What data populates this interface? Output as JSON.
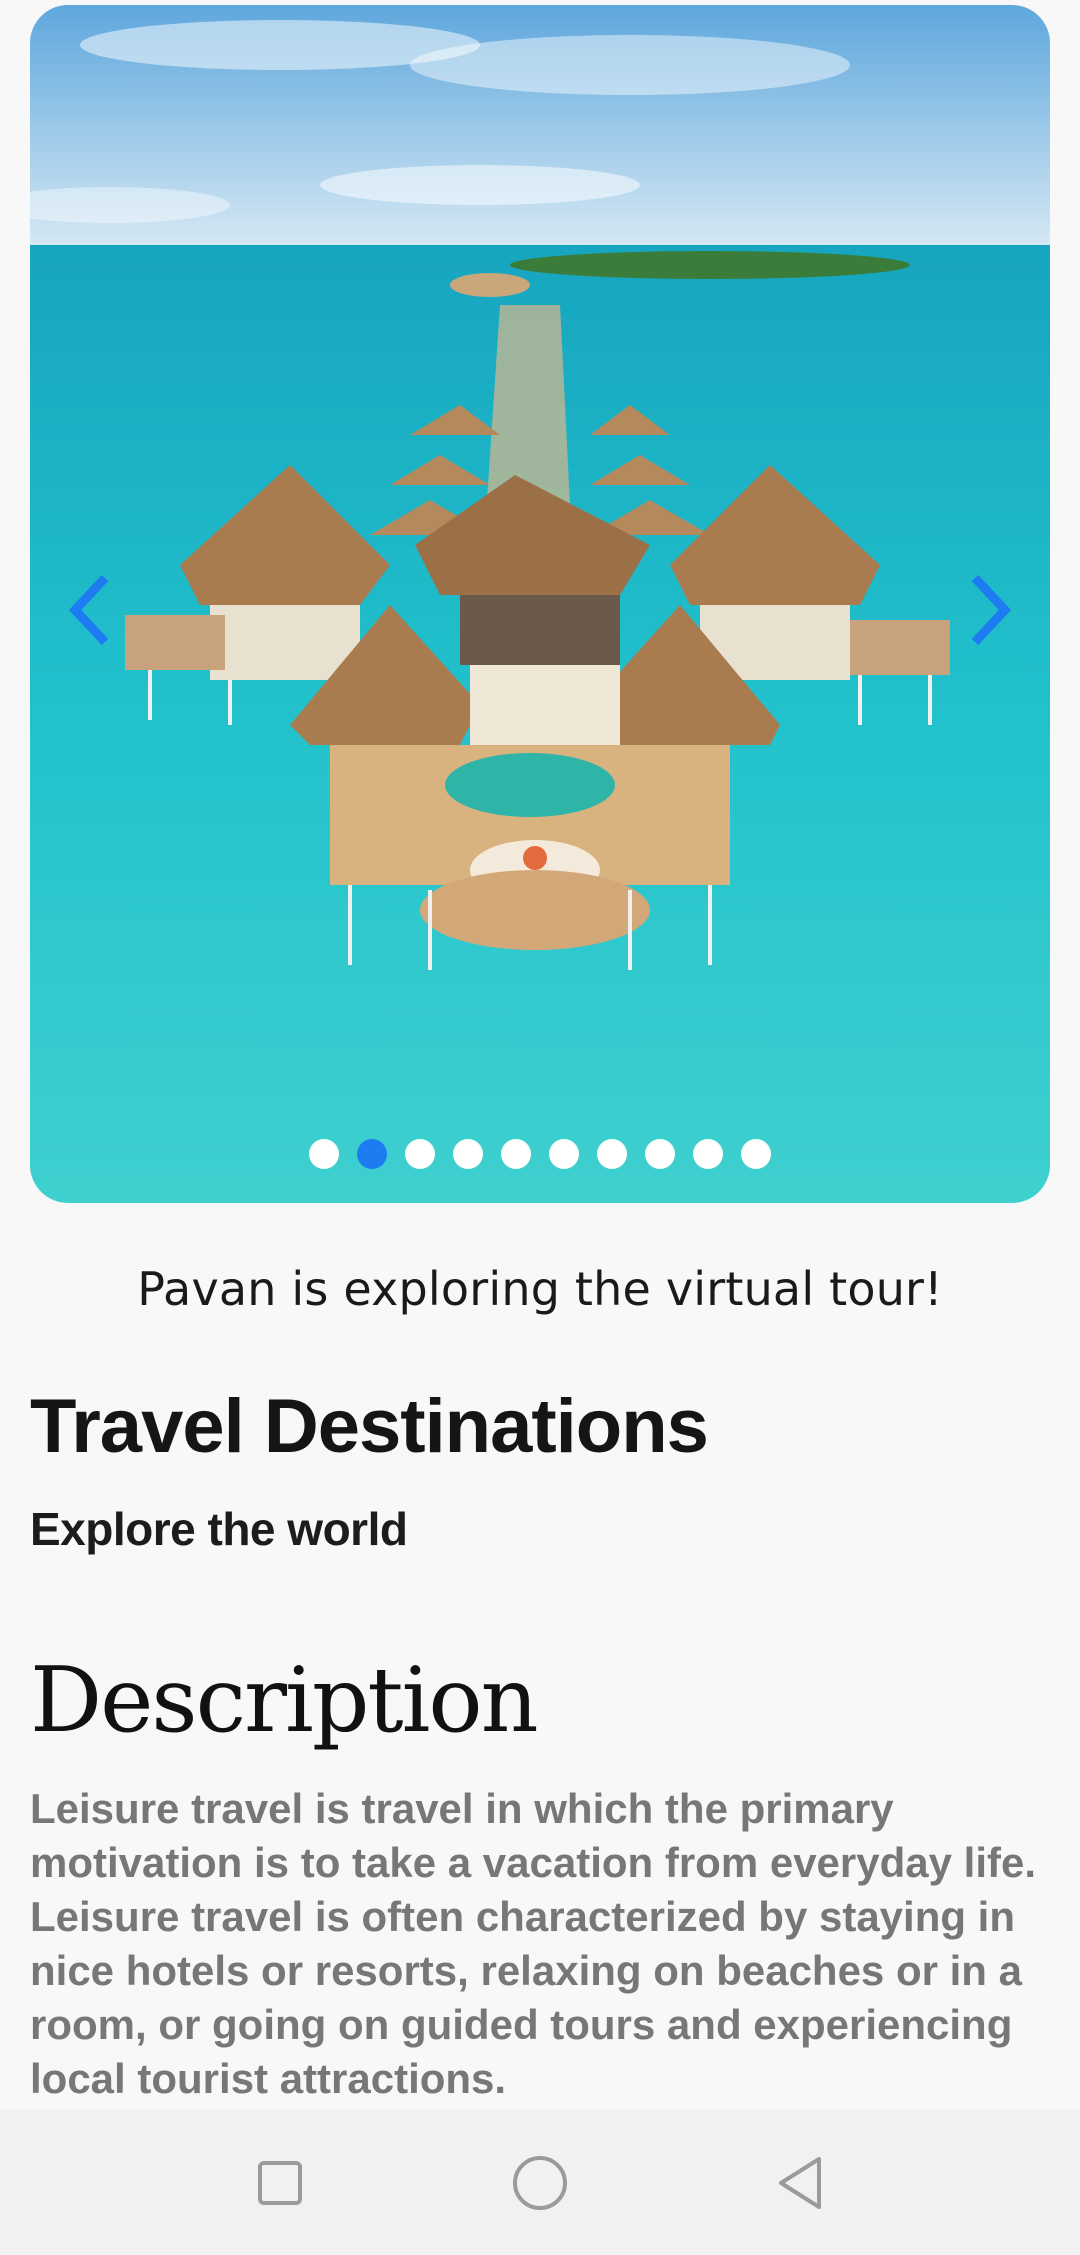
{
  "carousel": {
    "image_description_icon": "overwater-villas-photo",
    "prev_icon": "chevron-left-icon",
    "next_icon": "chevron-right-icon",
    "slide_count": 10,
    "active_index": 1,
    "accent_color": "#1e7cf2"
  },
  "caption": "Pavan is exploring the virtual tour!",
  "header": {
    "title": "Travel Destinations",
    "subtitle": "Explore the world"
  },
  "description": {
    "heading": "Description",
    "body": "Leisure travel is travel in which the primary motivation is to take a vacation from everyday life. Leisure travel is often characterized by staying in nice hotels or resorts, relaxing on beaches or in a room, or going on guided tours and experiencing local tourist attractions."
  },
  "navbar": {
    "recent_icon": "square-icon",
    "home_icon": "circle-icon",
    "back_icon": "triangle-back-icon"
  }
}
